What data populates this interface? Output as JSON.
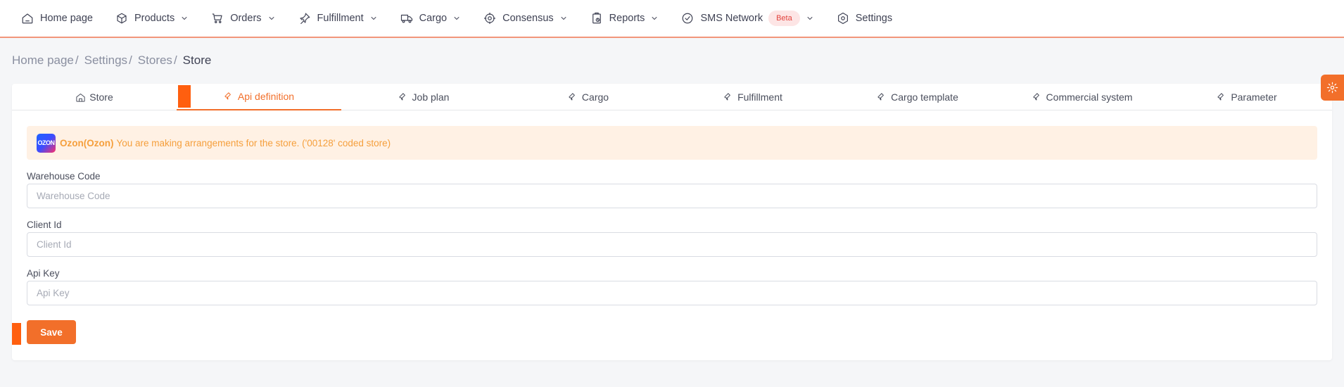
{
  "nav": {
    "home": "Home page",
    "products": "Products",
    "orders": "Orders",
    "fulfillment": "Fulfillment",
    "cargo": "Cargo",
    "consensus": "Consensus",
    "reports": "Reports",
    "sms_network": "SMS Network",
    "beta_badge": "Beta",
    "settings": "Settings"
  },
  "breadcrumb": {
    "home": "Home page",
    "settings": "Settings",
    "stores": "Stores",
    "current": "Store",
    "separator": "/"
  },
  "tabs": [
    {
      "label": "Store",
      "icon": "home-icon",
      "active": false
    },
    {
      "label": "Api definition",
      "icon": "wrench-icon",
      "active": true
    },
    {
      "label": "Job plan",
      "icon": "wrench-icon",
      "active": false
    },
    {
      "label": "Cargo",
      "icon": "wrench-icon",
      "active": false
    },
    {
      "label": "Fulfillment",
      "icon": "wrench-icon",
      "active": false
    },
    {
      "label": "Cargo template",
      "icon": "wrench-icon",
      "active": false
    },
    {
      "label": "Commercial system",
      "icon": "wrench-icon",
      "active": false
    },
    {
      "label": "Parameter",
      "icon": "wrench-icon",
      "active": false
    }
  ],
  "alert": {
    "logo_text": "OZON",
    "store_name": "Ozon(Ozon)",
    "message": "You are making arrangements for the store. ('00128' coded store)"
  },
  "form": {
    "warehouse_code": {
      "label": "Warehouse Code",
      "placeholder": "Warehouse Code",
      "value": ""
    },
    "client_id": {
      "label": "Client Id",
      "placeholder": "Client Id",
      "value": ""
    },
    "api_key": {
      "label": "Api Key",
      "placeholder": "Api Key",
      "value": ""
    },
    "save_label": "Save"
  },
  "colors": {
    "accent": "#f26f2a",
    "marker": "#ff5f0f",
    "alert_bg": "#fff1e4",
    "alert_text": "#f59f3c",
    "beta_bg": "#fde5e5",
    "beta_text": "#e2433d"
  }
}
